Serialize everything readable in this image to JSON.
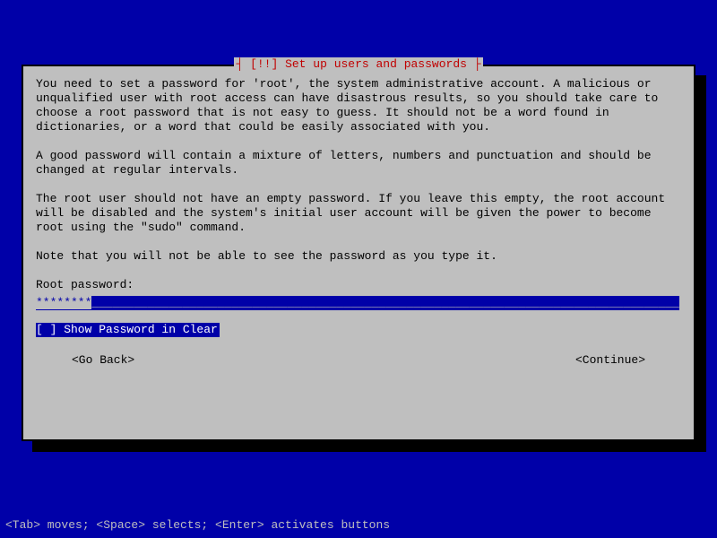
{
  "colors": {
    "bg": "#0000a8",
    "panel": "#bfbfbf",
    "title": "#c00000"
  },
  "dialog": {
    "title": "[!!] Set up users and passwords",
    "para1": "You need to set a password for 'root', the system administrative account. A malicious or unqualified user with root access can have disastrous results, so you should take care to choose a root password that is not easy to guess. It should not be a word found in dictionaries, or a word that could be easily associated with you.",
    "para2": "A good password will contain a mixture of letters, numbers and punctuation and should be changed at regular intervals.",
    "para3": "The root user should not have an empty password. If you leave this empty, the root account will be disabled and the system's initial user account will be given the power to become root using the \"sudo\" command.",
    "para4": "Note that you will not be able to see the password as you type it.",
    "prompt": "Root password:",
    "password_mask": "********",
    "underscores": "_______________________________________________________________________________________",
    "checkbox_state": "[ ]",
    "checkbox_label": " Show Password in Clear",
    "go_back": "<Go Back>",
    "continue": "<Continue>"
  },
  "hint": "<Tab> moves; <Space> selects; <Enter> activates buttons"
}
